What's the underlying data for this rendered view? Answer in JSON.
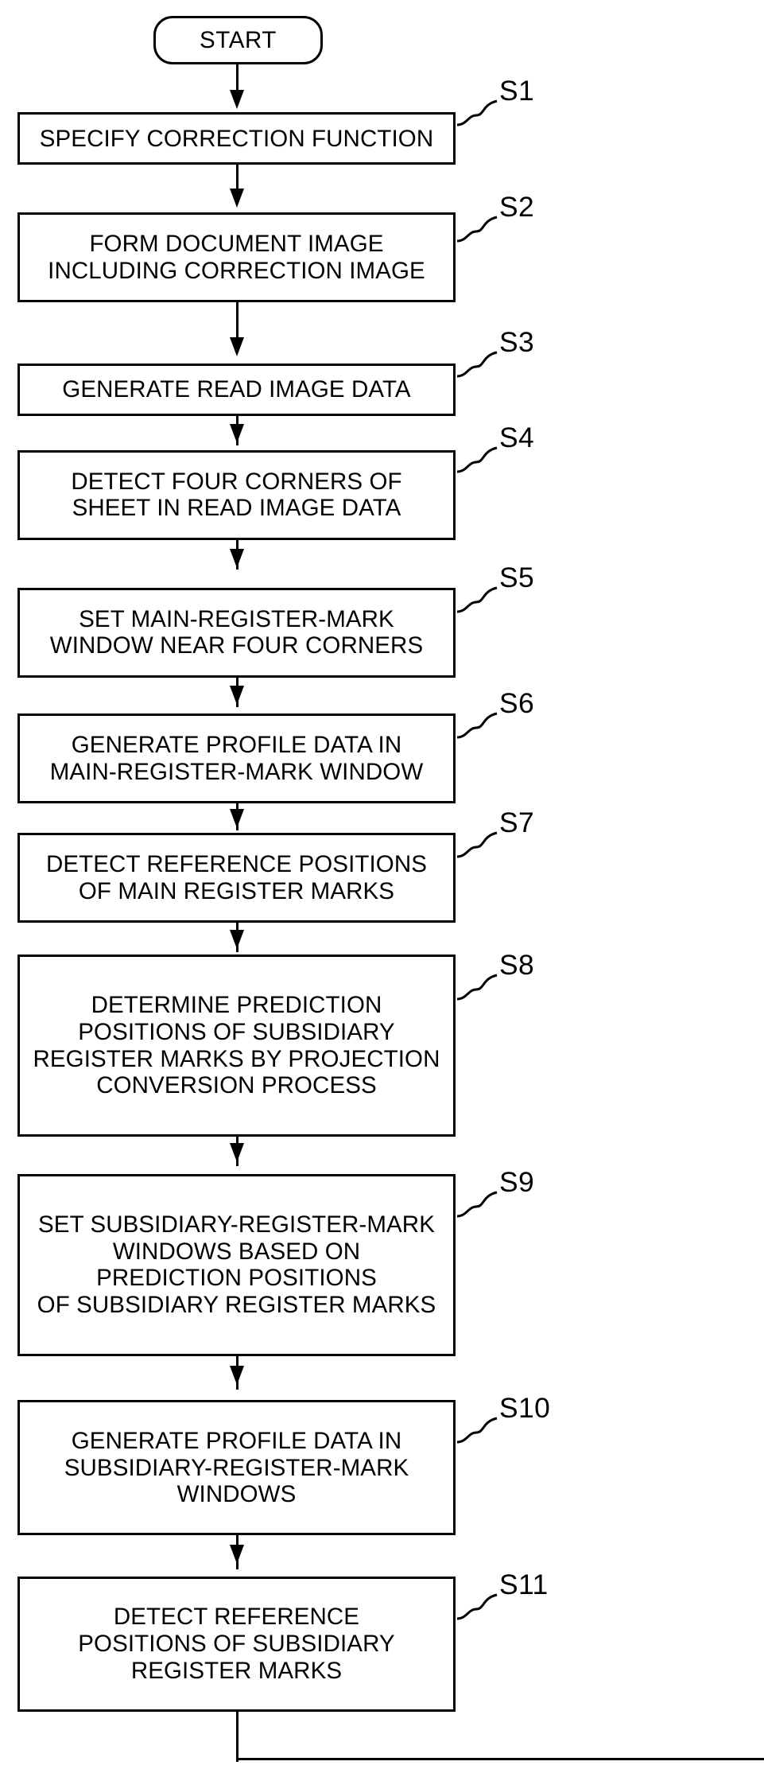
{
  "figure": {
    "type": "flowchart",
    "orientation": "vertical",
    "terminator": {
      "label": "START"
    },
    "steps": [
      {
        "ref": "S1",
        "text": "SPECIFY CORRECTION FUNCTION",
        "lines": 1
      },
      {
        "ref": "S2",
        "text": "FORM DOCUMENT IMAGE\nINCLUDING CORRECTION IMAGE",
        "lines": 2
      },
      {
        "ref": "S3",
        "text": "GENERATE READ IMAGE DATA",
        "lines": 1
      },
      {
        "ref": "S4",
        "text": "DETECT FOUR CORNERS OF\nSHEET IN READ IMAGE DATA",
        "lines": 2
      },
      {
        "ref": "S5",
        "text": "SET MAIN-REGISTER-MARK\nWINDOW NEAR FOUR CORNERS",
        "lines": 2
      },
      {
        "ref": "S6",
        "text": "GENERATE PROFILE DATA IN\nMAIN-REGISTER-MARK WINDOW",
        "lines": 2
      },
      {
        "ref": "S7",
        "text": "DETECT REFERENCE POSITIONS\nOF MAIN REGISTER MARKS",
        "lines": 2
      },
      {
        "ref": "S8",
        "text": "DETERMINE PREDICTION\nPOSITIONS OF SUBSIDIARY\nREGISTER MARKS BY PROJECTION\nCONVERSION PROCESS",
        "lines": 4
      },
      {
        "ref": "S9",
        "text": "SET SUBSIDIARY-REGISTER-MARK\nWINDOWS BASED ON\nPREDICTION POSITIONS\nOF SUBSIDIARY REGISTER MARKS",
        "lines": 4
      },
      {
        "ref": "S10",
        "text": "GENERATE PROFILE DATA IN\nSUBSIDIARY-REGISTER-MARK\nWINDOWS",
        "lines": 3
      },
      {
        "ref": "S11",
        "text": "DETECT REFERENCE\nPOSITIONS OF SUBSIDIARY\nREGISTER MARKS",
        "lines": 3
      }
    ],
    "colors": {
      "stroke": "#000000",
      "fill": "#ffffff",
      "text": "#000000"
    }
  }
}
